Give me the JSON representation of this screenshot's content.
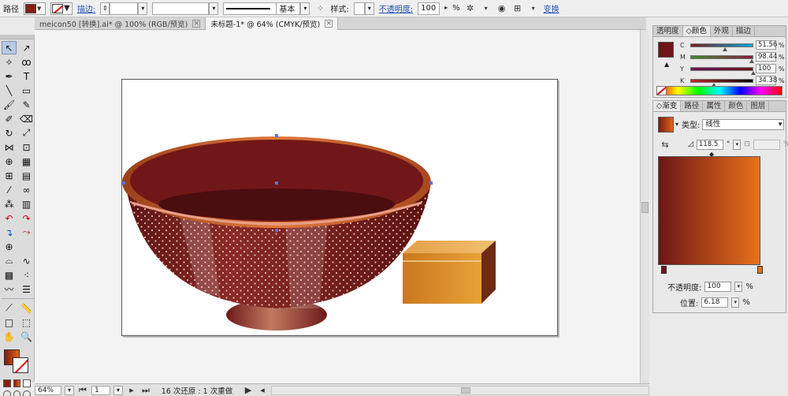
{
  "control_bar": {
    "object_label": "路径",
    "stroke_link": "描边:",
    "stroke_weight": "",
    "brush_field": "",
    "stroke_profile": "基本",
    "style_label": "样式:",
    "opacity_link": "不透明度:",
    "opacity_value": "100",
    "opacity_unit": "%",
    "transform_link": "变换"
  },
  "doc_tabs": [
    {
      "label": "meicon50 [转换].ai* @ 100% (RGB/预览)"
    },
    {
      "label": "未标题-1* @ 64% (CMYK/预览)"
    }
  ],
  "status_bar": {
    "zoom": "64%",
    "artboard_number": "1",
    "status_text": "16 次还原 : 1 次重做"
  },
  "color_panel": {
    "tabs": [
      "透明度",
      "颜色",
      "外观",
      "描边"
    ],
    "active_tab": "颜色",
    "swatch_color": "#6e1518",
    "channels": [
      {
        "name": "C",
        "value": "51.56",
        "bar": "linear-gradient(90deg,#7a1a18,#00a9e0)",
        "pos": 0.52
      },
      {
        "name": "M",
        "value": "98.44",
        "bar": "linear-gradient(90deg,#3f8b2a,#8a1a40)",
        "pos": 0.98
      },
      {
        "name": "Y",
        "value": "100",
        "bar": "linear-gradient(90deg,#6a1560,#6e1518)",
        "pos": 1.0
      },
      {
        "name": "K",
        "value": "34.38",
        "bar": "linear-gradient(90deg,#c32a2a,#000)",
        "pos": 0.34
      }
    ]
  },
  "gradient_panel": {
    "tabs": [
      "渐变",
      "路径",
      "属性",
      "颜色",
      "图层"
    ],
    "active_tab": "渐变",
    "type_label": "类型:",
    "type_value": "线性",
    "angle_value": "118.5",
    "angle_unit": "°",
    "ratio_unit": "%",
    "start_color": "#6e1518",
    "end_color": "#e8711a",
    "opacity_label": "不透明度:",
    "opacity_value": "100",
    "opacity_unit": "%",
    "position_label": "位置:",
    "position_value": "6.18",
    "position_unit": "%"
  },
  "colors": {
    "bowl_inner": "#6e1518",
    "bowl_rim": "#c8642c",
    "bowl_outer": "#7a2020",
    "box_light": "#e8a030",
    "box_dark": "#6e2a12"
  }
}
